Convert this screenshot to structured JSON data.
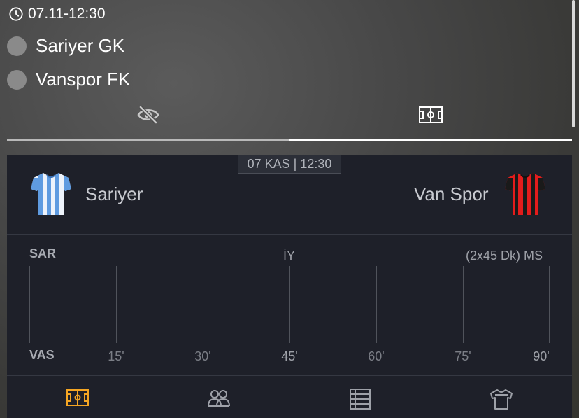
{
  "header": {
    "datetime": "07.11-12:30",
    "teams": [
      {
        "name": "Sariyer GK"
      },
      {
        "name": "Vanspor FK"
      }
    ]
  },
  "tabs": [
    {
      "icon": "eye-slash-icon",
      "active": false
    },
    {
      "icon": "pitch-icon",
      "active": true
    }
  ],
  "match": {
    "date_badge": "07 KAS | 12:30",
    "home": {
      "name": "Sariyer",
      "shirt_icon": "blue-white-striped-shirt-icon"
    },
    "away": {
      "name": "Van Spor",
      "shirt_icon": "red-black-striped-shirt-icon"
    }
  },
  "timeline": {
    "home_abbr": "SAR",
    "away_abbr": "VAS",
    "half_label": "İY",
    "full_label": "(2x45 Dk) MS",
    "minutes": [
      "15'",
      "30'",
      "45'",
      "60'",
      "75'",
      "90'"
    ]
  },
  "bottom_nav": [
    {
      "icon": "pitch-icon",
      "active": true
    },
    {
      "icon": "lineup-icon",
      "active": false
    },
    {
      "icon": "standings-icon",
      "active": false
    },
    {
      "icon": "shirt-icon",
      "active": false
    }
  ],
  "colors": {
    "panel_bg": "#1e2029",
    "accent": "#f5a623",
    "home_shirt": "#6aa8e8",
    "away_shirt": "#e01f1f"
  }
}
